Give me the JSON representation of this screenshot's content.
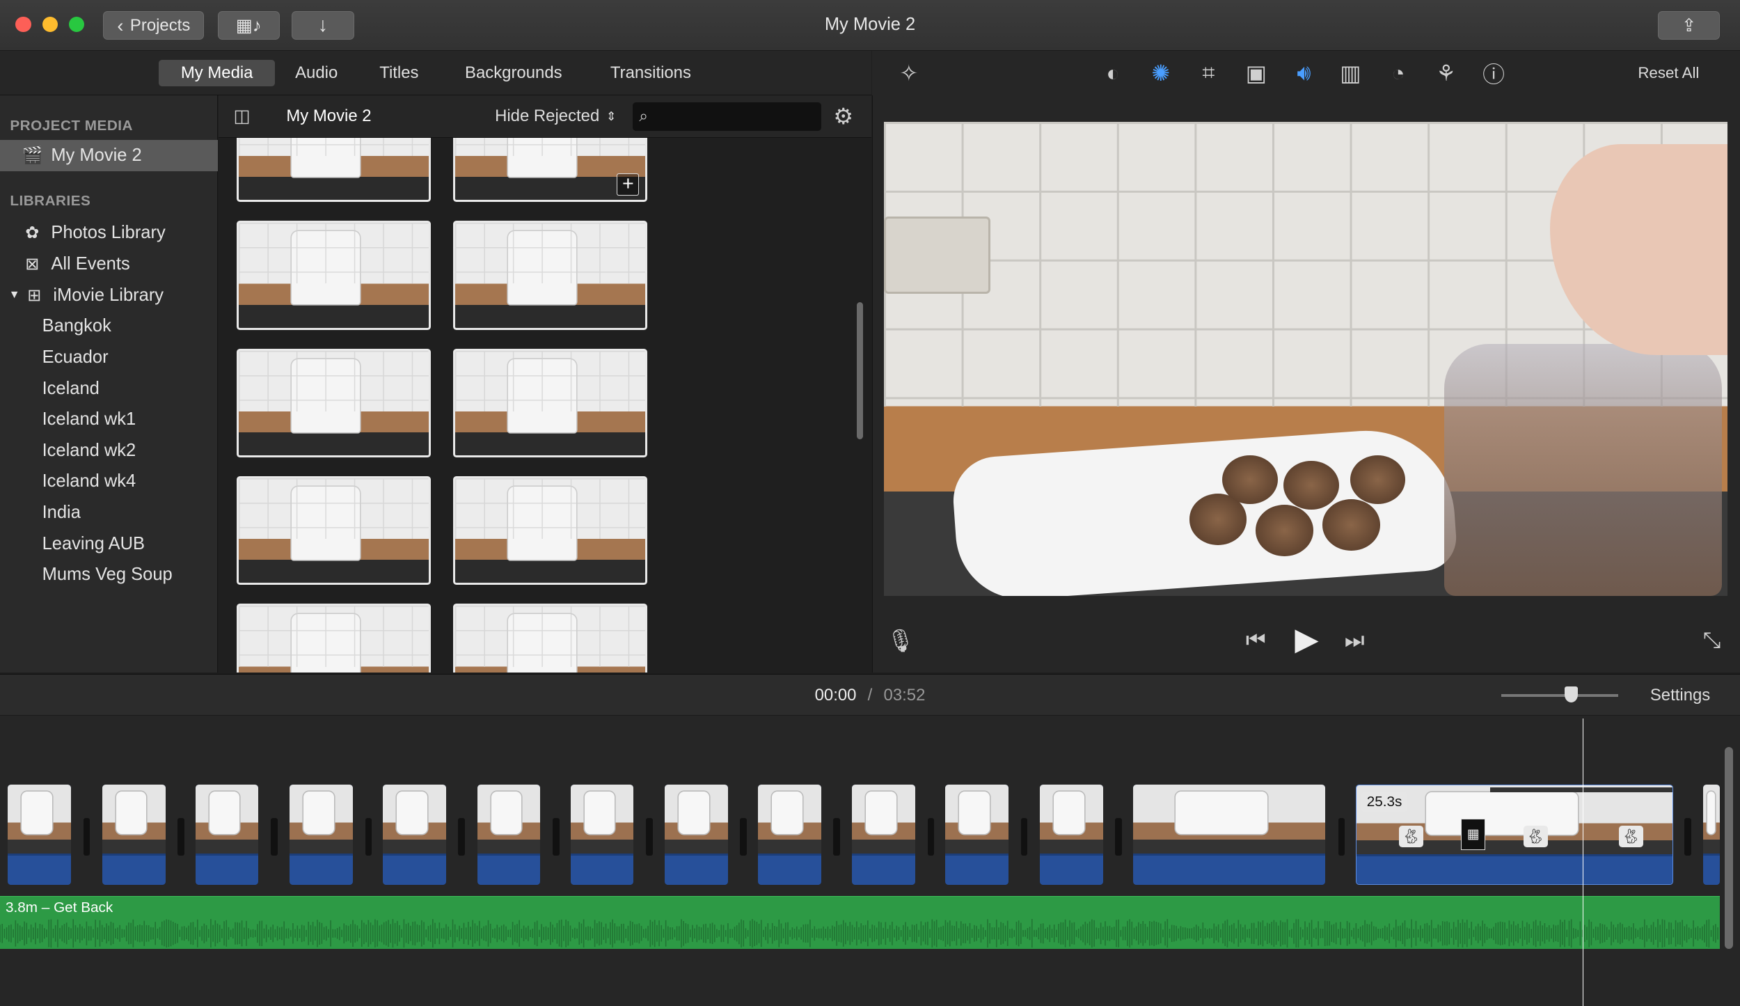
{
  "window": {
    "title": "My Movie 2"
  },
  "toolbar": {
    "projects_label": "Projects"
  },
  "browser": {
    "tabs": [
      {
        "label": "My Media",
        "active": true
      },
      {
        "label": "Audio",
        "active": false
      },
      {
        "label": "Titles",
        "active": false
      },
      {
        "label": "Backgrounds",
        "active": false
      },
      {
        "label": "Transitions",
        "active": false
      }
    ],
    "header": {
      "title": "My Movie 2",
      "filter": "Hide Rejected",
      "search_value": ""
    }
  },
  "sidebar": {
    "project_media_heading": "PROJECT MEDIA",
    "project": "My Movie 2",
    "libraries_heading": "LIBRARIES",
    "photos_library": "Photos Library",
    "all_events": "All Events",
    "imovie_library": "iMovie Library",
    "events": [
      "Bangkok",
      "Ecuador",
      "Iceland",
      "Iceland wk1",
      "Iceland wk2",
      "Iceland wk4",
      "India",
      "Leaving AUB",
      "Mums Veg Soup"
    ]
  },
  "viewer": {
    "reset_all": "Reset All"
  },
  "timeline": {
    "current_time": "00:00",
    "separator": "/",
    "total_time": "03:52",
    "settings_label": "Settings",
    "zoom_level": 0.6,
    "speed_clip_label": "25.3s",
    "audio_clip_label": "3.8m – Get Back"
  },
  "colors": {
    "accent": "#4a9eff",
    "audio_track": "#2d9a45",
    "clip_bar": "#27509a"
  }
}
